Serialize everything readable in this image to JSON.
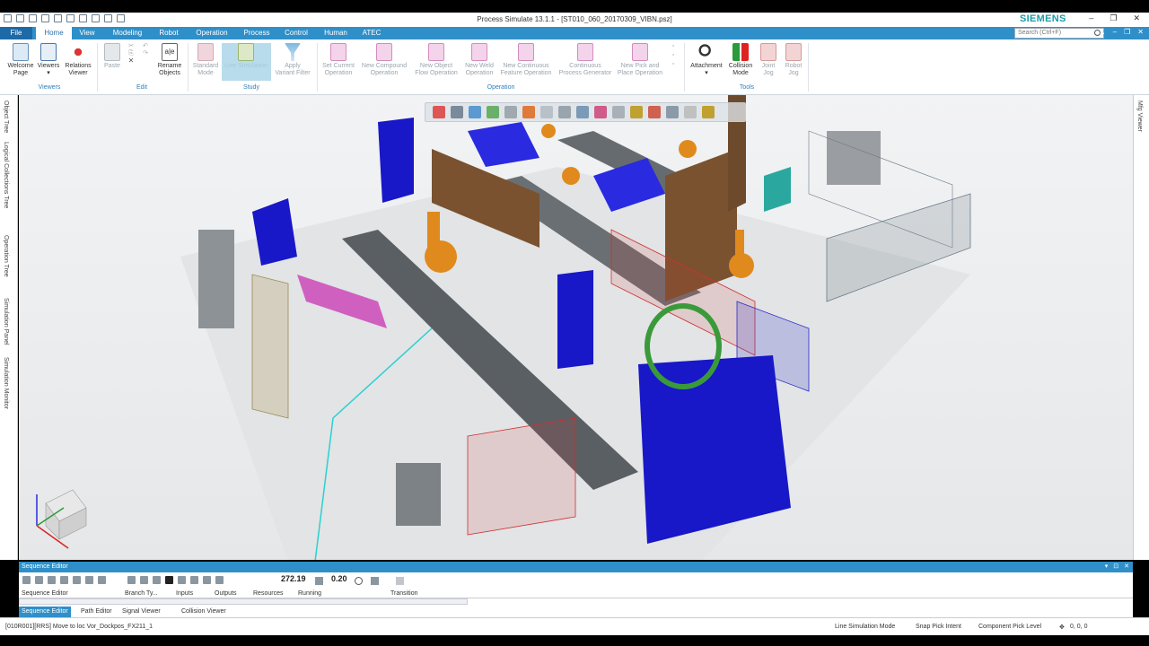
{
  "window": {
    "title": "Process Simulate 13.1.1 - [ST010_060_20170309_VIBN.psz]",
    "brand": "SIEMENS",
    "controls": [
      "–",
      "❐",
      "✕"
    ]
  },
  "menu": {
    "tabs": [
      "File",
      "Home",
      "View",
      "Modeling",
      "Robot",
      "Operation",
      "Process",
      "Control",
      "Human",
      "ATEC"
    ],
    "active": "Home",
    "search_placeholder": "Search (Ctrl+F)"
  },
  "ribbon": {
    "viewers": {
      "label": "Viewers",
      "buttons": [
        {
          "line1": "Welcome",
          "line2": "Page",
          "icon": "welcome-page-icon"
        },
        {
          "line1": "Viewers",
          "line2": "▾",
          "icon": "viewers-icon"
        },
        {
          "line1": "Relations",
          "line2": "Viewer",
          "icon": "relations-viewer-icon"
        }
      ]
    },
    "edit": {
      "label": "Edit",
      "paste": "Paste",
      "rename_line1": "Rename",
      "rename_line2": "Objects"
    },
    "study": {
      "label": "Study",
      "buttons": [
        {
          "line1": "Standard",
          "line2": "Mode"
        },
        {
          "line1": "Line Simulation",
          "line2": ""
        },
        {
          "line1": "Apply",
          "line2": "Variant Filter"
        }
      ]
    },
    "operation": {
      "label": "Operation",
      "buttons": [
        {
          "line1": "Set Current",
          "line2": "Operation"
        },
        {
          "line1": "New Compound",
          "line2": "Operation"
        },
        {
          "line1": "New Object",
          "line2": "Flow Operation"
        },
        {
          "line1": "New Weld",
          "line2": "Operation"
        },
        {
          "line1": "New Continuous",
          "line2": "Feature Operation"
        },
        {
          "line1": "Continuous",
          "line2": "Process Generator"
        },
        {
          "line1": "New Pick and",
          "line2": "Place Operation"
        }
      ]
    },
    "tools": {
      "label": "Tools",
      "buttons": [
        {
          "line1": "Attachment",
          "line2": "▾"
        },
        {
          "line1": "Collision",
          "line2": "Mode"
        },
        {
          "line1": "Joint",
          "line2": "Jog"
        },
        {
          "line1": "Robot",
          "line2": "Jog"
        }
      ]
    }
  },
  "left_tabs": [
    "Object Tree",
    "Logical Collections Tree",
    "Operation Tree",
    "Simulation Panel",
    "Simulation Monitor"
  ],
  "right_tab": "Mfg Viewer",
  "sequence_editor": {
    "title": "Sequence Editor",
    "time": "272.19",
    "step": "0.20",
    "columns": [
      "Sequence Editor",
      "Branch Ty...",
      "Inputs",
      "Outputs",
      "Resources",
      "Running",
      "Transition"
    ]
  },
  "bottom_tabs": [
    "Sequence Editor",
    "Path Editor",
    "Signal Viewer",
    "Collision Viewer"
  ],
  "status": {
    "message": "[010R001][RRS] Move to loc Vor_Dockpos_FX211_1",
    "mode": "Line Simulation Mode",
    "snap": "Snap Pick Intent",
    "pick": "Component Pick Level",
    "coords": "0, 0, 0"
  },
  "colors": {
    "accent": "#2f8fc8",
    "robot": "#e08a1e",
    "fixture": "#1818c8",
    "fence_red": "#d03030"
  }
}
